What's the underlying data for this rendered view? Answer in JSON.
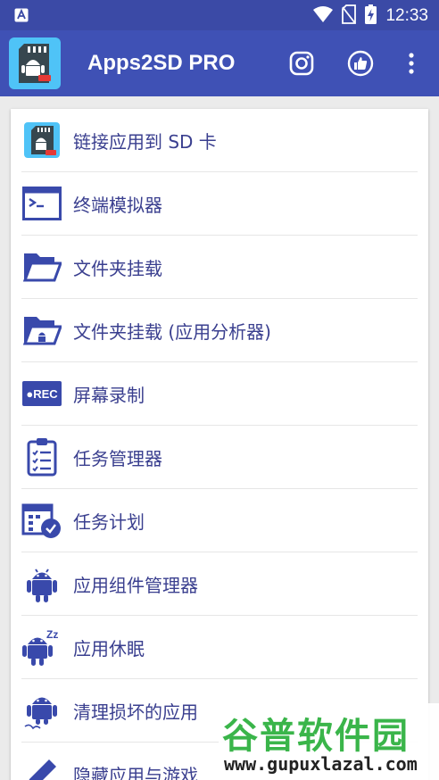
{
  "status_bar": {
    "time": "12:33",
    "notification_icon": "a-icon"
  },
  "app_bar": {
    "title": "Apps2SD PRO",
    "actions": [
      "instagram-icon",
      "thumbs-up-icon",
      "more-vert-icon"
    ]
  },
  "menu": {
    "items": [
      {
        "label": "链接应用到 SD 卡",
        "icon": "sd-card-icon"
      },
      {
        "label": "终端模拟器",
        "icon": "terminal-icon"
      },
      {
        "label": "文件夹挂载",
        "icon": "folder-open-icon"
      },
      {
        "label": "文件夹挂载 (应用分析器)",
        "icon": "folder-android-icon"
      },
      {
        "label": "屏幕录制",
        "icon": "rec-icon",
        "icon_text": "●REC"
      },
      {
        "label": "任务管理器",
        "icon": "clipboard-list-icon"
      },
      {
        "label": "任务计划",
        "icon": "calendar-clock-icon"
      },
      {
        "label": "应用组件管理器",
        "icon": "android-icon"
      },
      {
        "label": "应用休眠",
        "icon": "android-sleep-icon",
        "icon_text": "Zz"
      },
      {
        "label": "清理损坏的应用",
        "icon": "android-broken-icon"
      },
      {
        "label": "隐藏应用与游戏",
        "icon": "pencil-icon"
      }
    ]
  },
  "watermark": {
    "title": "谷普软件园",
    "url": "www.gupuxlazal.com"
  },
  "colors": {
    "status_bar": "#3b4aa6",
    "app_bar": "#3f51b5",
    "menu_text": "#3a3f8f",
    "icon": "#3949ab",
    "logo_bg": "#4fc3f7",
    "watermark_green": "#3ab54a"
  }
}
